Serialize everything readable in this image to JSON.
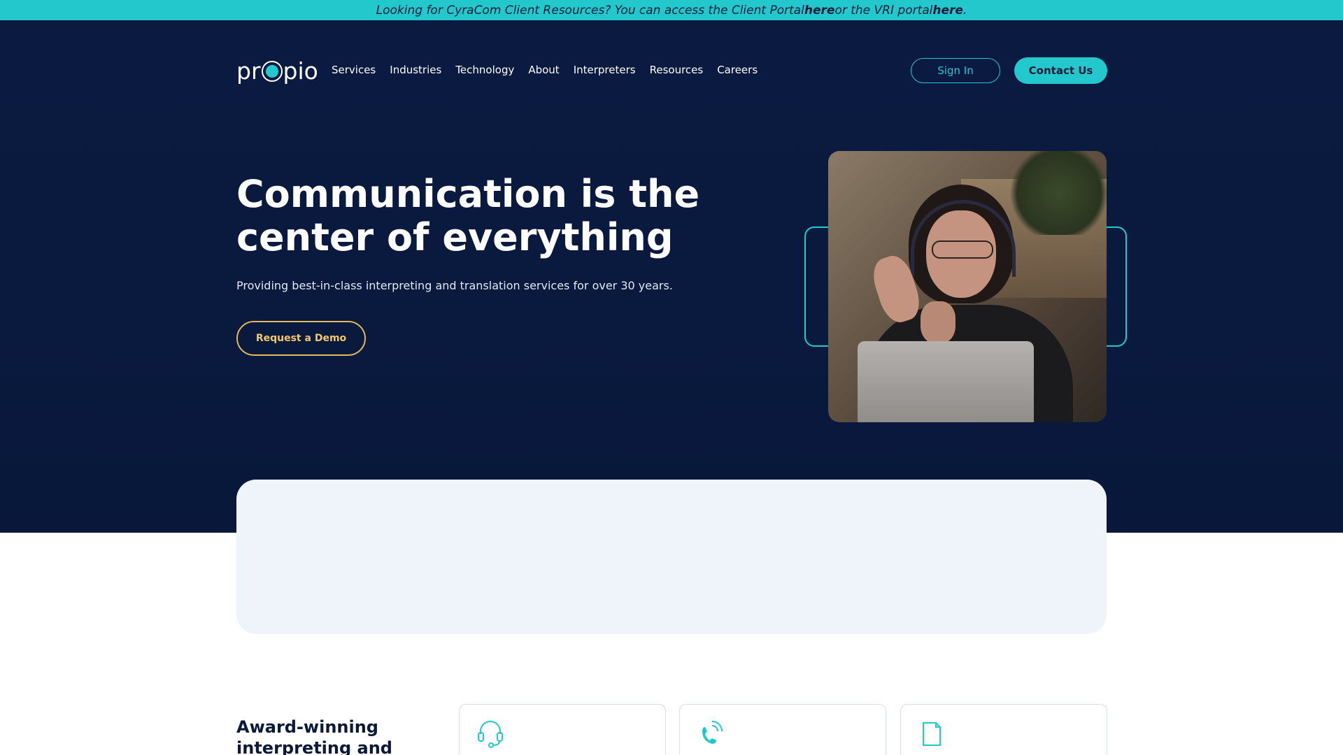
{
  "banner": {
    "text_pre": "Looking for CyraCom Client Resources? You can access the Client Portal ",
    "link1": "here",
    "text_mid": " or the VRI portal ",
    "link2": "here",
    "text_post": "."
  },
  "logo": {
    "pre": "pr",
    "post": "pio"
  },
  "nav": {
    "items": [
      "Services",
      "Industries",
      "Technology",
      "About",
      "Interpreters",
      "Resources",
      "Careers"
    ],
    "signin_label": "Sign In",
    "contact_label": "Contact Us"
  },
  "hero": {
    "headline": "Communication is the center of everything",
    "subtext": "Providing best-in-class interpreting and translation services for over 30 years.",
    "cta_label": "Request a Demo"
  },
  "section": {
    "title": "Award-winning interpreting and"
  },
  "cards": [
    {
      "icon": "headset-icon"
    },
    {
      "icon": "phone-ringing-icon"
    },
    {
      "icon": "document-icon"
    }
  ],
  "colors": {
    "accent": "#23c8cc",
    "navy": "#0b1a40",
    "gold": "#e3b75a",
    "panel": "#eff4fb"
  }
}
